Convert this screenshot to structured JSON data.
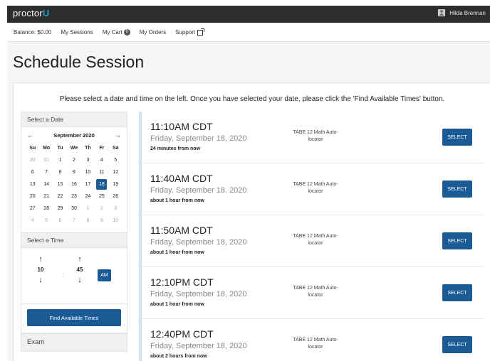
{
  "app": {
    "logo_main": "proctor",
    "logo_accent": "U",
    "user_name": "Hilda Brennan"
  },
  "nav": {
    "balance": "Balance: $0.00",
    "my_sessions": "My Sessions",
    "my_cart": "My Cart",
    "cart_count": "0",
    "my_orders": "My Orders",
    "support": "Support"
  },
  "page": {
    "title": "Schedule Session",
    "instructions": "Please select a date and time on the left. Once you have selected your date, please click the 'Find Available Times' button."
  },
  "calendar": {
    "header": "Select a Date",
    "month_label": "September 2020",
    "prev": "←",
    "next": "→",
    "weekdays": [
      "Su",
      "Mo",
      "Tu",
      "We",
      "Th",
      "Fr",
      "Sa"
    ],
    "weeks": [
      [
        "30",
        "31",
        "1",
        "2",
        "3",
        "4",
        "5"
      ],
      [
        "6",
        "7",
        "8",
        "9",
        "10",
        "11",
        "12"
      ],
      [
        "13",
        "14",
        "15",
        "16",
        "17",
        "18",
        "19"
      ],
      [
        "20",
        "21",
        "22",
        "23",
        "24",
        "25",
        "26"
      ],
      [
        "27",
        "28",
        "29",
        "30",
        "1",
        "2",
        "3"
      ],
      [
        "4",
        "5",
        "6",
        "7",
        "8",
        "9",
        "10"
      ]
    ],
    "selected_day": "18"
  },
  "time": {
    "header": "Select a Time",
    "up": "↑",
    "down": "↓",
    "hour": "10",
    "separator": ":",
    "minute": "45",
    "ampm": "AM"
  },
  "find_button": "Find Available Times",
  "exam_header": "Exam",
  "sessions": [
    {
      "time": "11:10AM CDT",
      "date": "Friday, September 18, 2020",
      "relative": "24 minutes from now",
      "exam": "TABE 12 Math Auto-locator",
      "action": "SELECT"
    },
    {
      "time": "11:40AM CDT",
      "date": "Friday, September 18, 2020",
      "relative": "about 1 hour from now",
      "exam": "TABE 12 Math Auto-locator",
      "action": "SELECT"
    },
    {
      "time": "11:50AM CDT",
      "date": "Friday, September 18, 2020",
      "relative": "about 1 hour from now",
      "exam": "TABE 12 Math Auto-locator",
      "action": "SELECT"
    },
    {
      "time": "12:10PM CDT",
      "date": "Friday, September 18, 2020",
      "relative": "about 1 hour from now",
      "exam": "TABE 12 Math Auto-locator",
      "action": "SELECT"
    },
    {
      "time": "12:40PM CDT",
      "date": "Friday, September 18, 2020",
      "relative": "about 2 hours from now",
      "exam": "TABE 12 Math Auto-locator",
      "action": "SELECT"
    }
  ],
  "colors": {
    "primary": "#1a5b96",
    "topbar": "#2d2d2d",
    "accent": "#1f9bd6"
  }
}
